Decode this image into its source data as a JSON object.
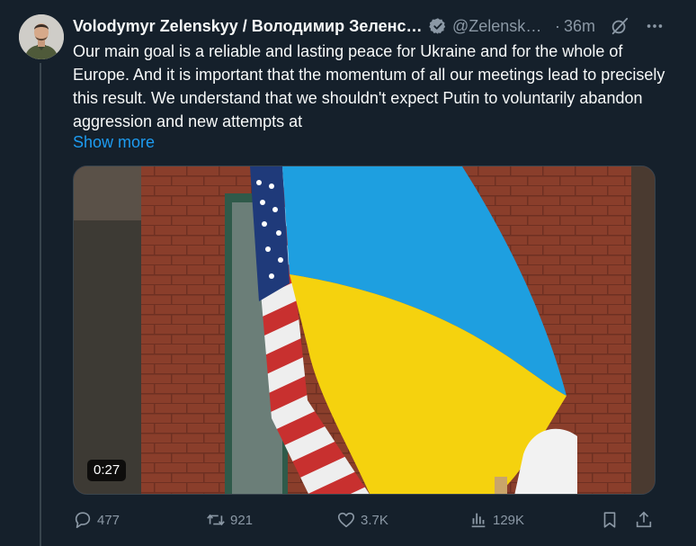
{
  "tweet": {
    "author_name": "Volodymyr Zelenskyy / Володимир Зеленський",
    "handle": "@ZelenskyyUa",
    "separator": "·",
    "time": "36m",
    "text": "Our main goal is a reliable and lasting peace for Ukraine and for the whole of Europe. And it is important that the momentum of all our meetings lead to precisely this result. We understand that we shouldn't expect Putin to voluntarily abandon aggression and new attempts at",
    "show_more_label": "Show more",
    "media": {
      "video_duration": "0:27"
    },
    "stats": {
      "replies": "477",
      "reposts": "921",
      "likes": "3.7K",
      "views": "129K"
    }
  },
  "icons": {
    "verified": "verified-badge-icon",
    "grok": "grok-icon",
    "more": "more-options-icon",
    "reply": "reply-icon",
    "repost": "repost-icon",
    "like": "like-icon",
    "views": "views-icon",
    "bookmark": "bookmark-icon",
    "share": "share-icon"
  },
  "colors": {
    "background": "#15202b",
    "text_primary": "#f7f9f9",
    "text_secondary": "#8b98a5",
    "link": "#1d9bf0",
    "flag_blue": "#1e9fe0",
    "flag_yellow": "#f5d20e"
  }
}
